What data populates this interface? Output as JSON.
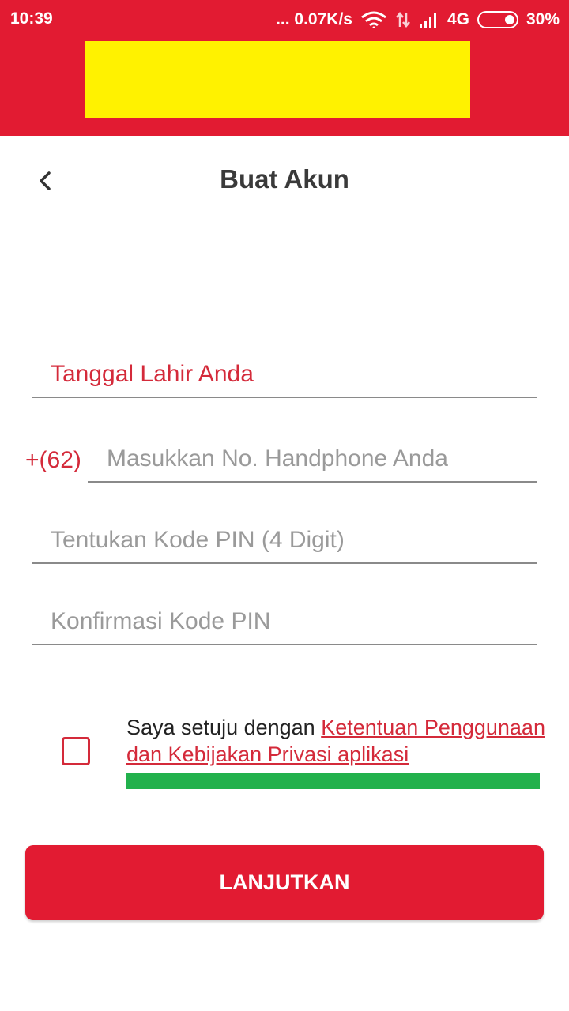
{
  "status_bar": {
    "time": "10:39",
    "network_speed": "... 0.07K/s",
    "network_type": "4G",
    "battery": "30%",
    "icons": [
      "wifi-icon",
      "data-arrows-icon",
      "signal-icon",
      "battery-icon"
    ]
  },
  "colors": {
    "brand_red": "#e21b32",
    "banner_yellow": "#fff200",
    "accent_green": "#22b14c",
    "label_red": "#d42a3a"
  },
  "header": {
    "title": "Buat Akun",
    "back_icon": "chevron-left-icon"
  },
  "form": {
    "dob": {
      "placeholder": "Tanggal Lahir Anda"
    },
    "phone": {
      "prefix": "+(62)",
      "placeholder": "Masukkan No. Handphone Anda"
    },
    "pin": {
      "placeholder": "Tentukan Kode PIN (4 Digit)"
    },
    "pin_confirm": {
      "placeholder": "Konfirmasi Kode PIN"
    }
  },
  "agreement": {
    "text": "Saya setuju dengan ",
    "link": "Ketentuan Penggunaan dan Kebijakan Privasi aplikasi",
    "checked": false
  },
  "submit": {
    "label": "LANJUTKAN"
  }
}
